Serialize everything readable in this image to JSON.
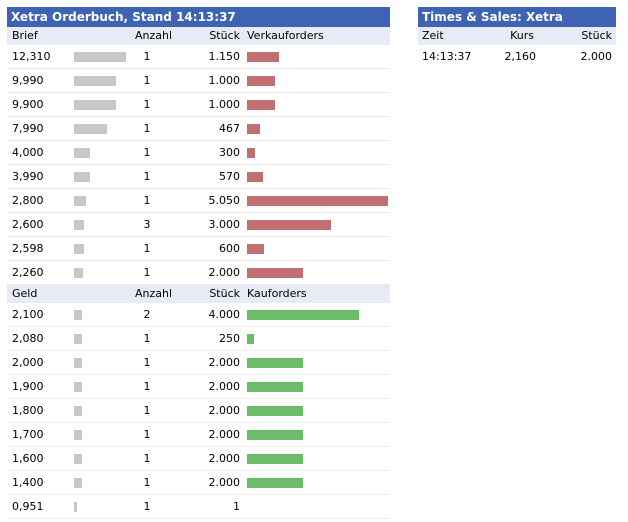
{
  "orderbook": {
    "title": "Xetra Orderbuch, Stand 14:13:37",
    "ask_header": {
      "price": "Brief",
      "count": "Anzahl",
      "qty": "Stück",
      "orders": "Verkauforders"
    },
    "asks": [
      {
        "price": "12,310",
        "count": "1",
        "qty": "1.150",
        "shade": 0.9,
        "volume": 1150
      },
      {
        "price": "9,990",
        "count": "1",
        "qty": "1.000",
        "shade": 0.73,
        "volume": 1000
      },
      {
        "price": "9,900",
        "count": "1",
        "qty": "1.000",
        "shade": 0.72,
        "volume": 1000
      },
      {
        "price": "7,990",
        "count": "1",
        "qty": "467",
        "shade": 0.57,
        "volume": 467
      },
      {
        "price": "4,000",
        "count": "1",
        "qty": "300",
        "shade": 0.28,
        "volume": 300
      },
      {
        "price": "3,990",
        "count": "1",
        "qty": "570",
        "shade": 0.28,
        "volume": 570
      },
      {
        "price": "2,800",
        "count": "1",
        "qty": "5.050",
        "shade": 0.2,
        "volume": 5050
      },
      {
        "price": "2,600",
        "count": "3",
        "qty": "3.000",
        "shade": 0.18,
        "volume": 3000
      },
      {
        "price": "2,598",
        "count": "1",
        "qty": "600",
        "shade": 0.17,
        "volume": 600
      },
      {
        "price": "2,260",
        "count": "1",
        "qty": "2.000",
        "shade": 0.16,
        "volume": 2000
      }
    ],
    "bid_header": {
      "price": "Geld",
      "count": "Anzahl",
      "qty": "Stück",
      "orders": "Kauforders"
    },
    "bids": [
      {
        "price": "2,100",
        "count": "2",
        "qty": "4.000",
        "shade": 0.13,
        "volume": 4000
      },
      {
        "price": "2,080",
        "count": "1",
        "qty": "250",
        "shade": 0.13,
        "volume": 250
      },
      {
        "price": "2,000",
        "count": "1",
        "qty": "2.000",
        "shade": 0.13,
        "volume": 2000
      },
      {
        "price": "1,900",
        "count": "1",
        "qty": "2.000",
        "shade": 0.13,
        "volume": 2000
      },
      {
        "price": "1,800",
        "count": "1",
        "qty": "2.000",
        "shade": 0.13,
        "volume": 2000
      },
      {
        "price": "1,700",
        "count": "1",
        "qty": "2.000",
        "shade": 0.13,
        "volume": 2000
      },
      {
        "price": "1,600",
        "count": "1",
        "qty": "2.000",
        "shade": 0.13,
        "volume": 2000
      },
      {
        "price": "1,400",
        "count": "1",
        "qty": "2.000",
        "shade": 0.13,
        "volume": 2000
      },
      {
        "price": "0,951",
        "count": "1",
        "qty": "1",
        "shade": 0.06,
        "volume": 1
      }
    ],
    "colors": {
      "sell": "#c07070",
      "buy": "#6cbd6a",
      "header": "#3f63b4"
    }
  },
  "times_sales": {
    "title": "Times & Sales: Xetra",
    "header": {
      "time": "Zeit",
      "price": "Kurs",
      "qty": "Stück"
    },
    "rows": [
      {
        "time": "14:13:37",
        "price": "2,160",
        "qty": "2.000"
      }
    ]
  }
}
